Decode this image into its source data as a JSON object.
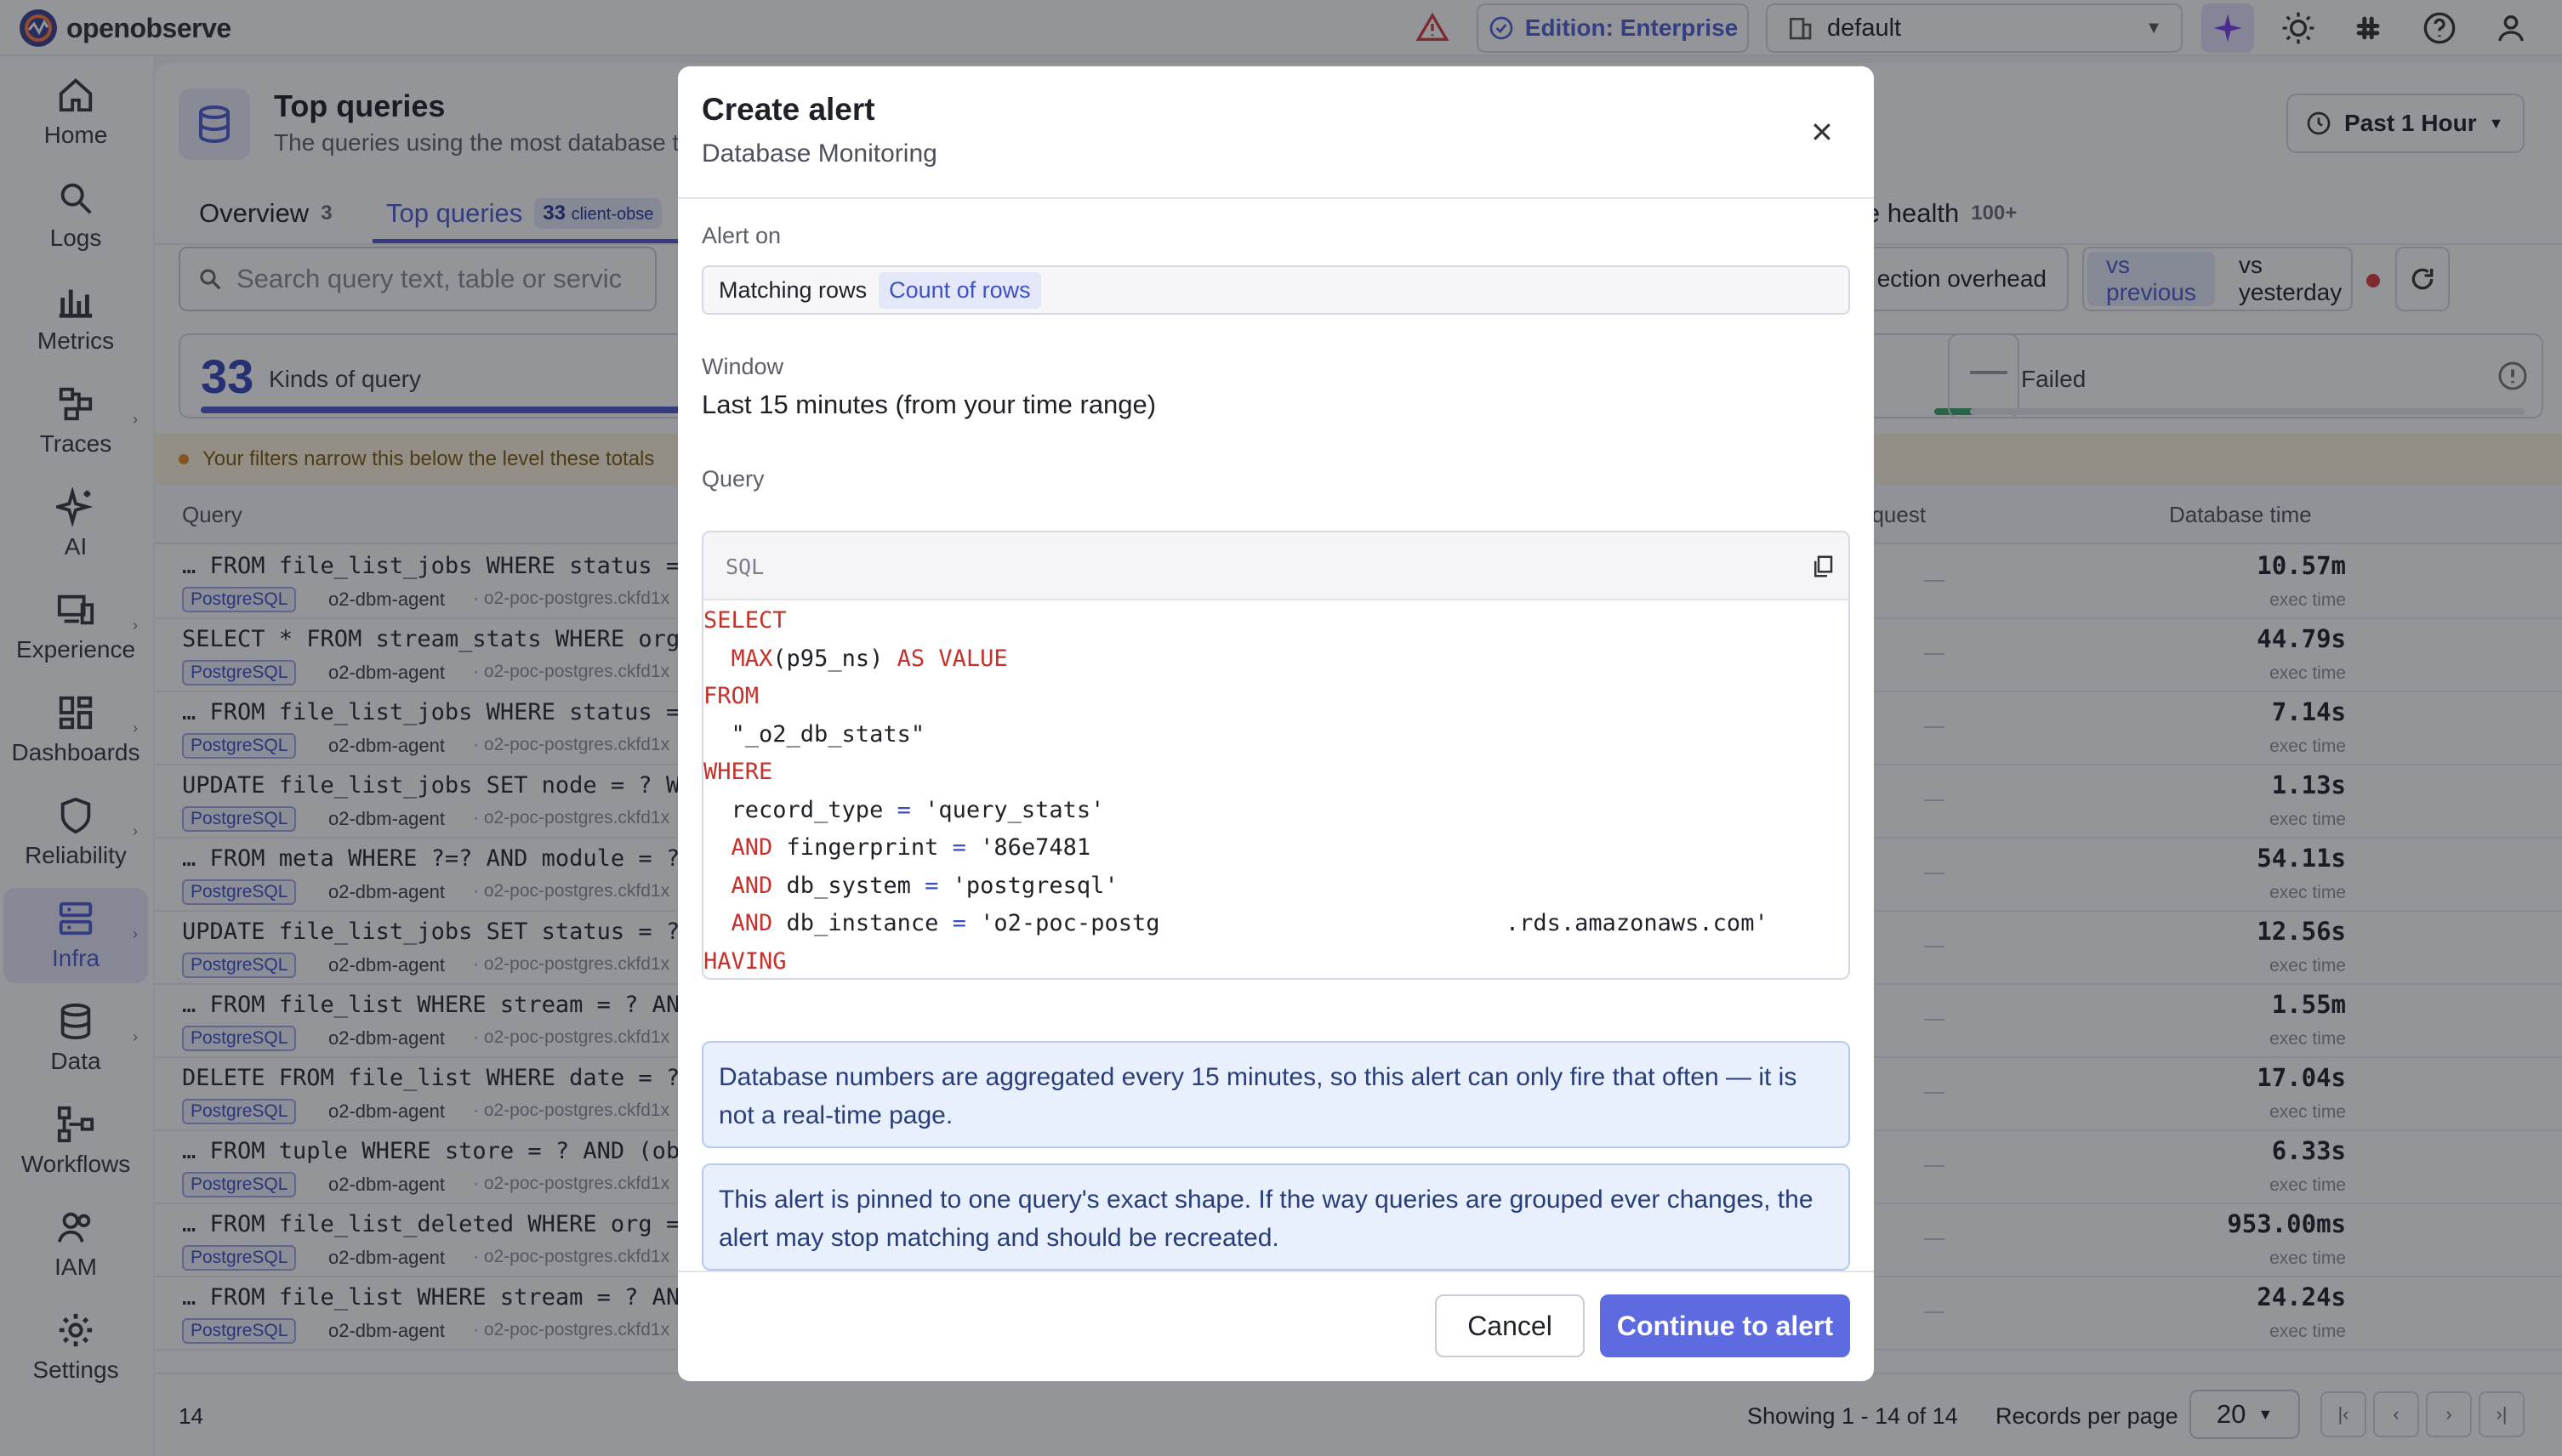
{
  "app": {
    "brand": "openobserve"
  },
  "topbar": {
    "edition_label": "Edition: Enterprise",
    "org_label": "default"
  },
  "sidebar": {
    "items": [
      {
        "label": "Home",
        "icon": "home-icon"
      },
      {
        "label": "Logs",
        "icon": "search-icon"
      },
      {
        "label": "Metrics",
        "icon": "bar-chart-icon"
      },
      {
        "label": "Traces",
        "icon": "traces-icon"
      },
      {
        "label": "AI",
        "icon": "sparkle-icon"
      },
      {
        "label": "Experience",
        "icon": "devices-icon"
      },
      {
        "label": "Dashboards",
        "icon": "dashboard-icon"
      },
      {
        "label": "Reliability",
        "icon": "shield-icon"
      },
      {
        "label": "Infra",
        "icon": "server-icon"
      },
      {
        "label": "Data",
        "icon": "database-icon"
      },
      {
        "label": "Workflows",
        "icon": "workflow-icon"
      },
      {
        "label": "IAM",
        "icon": "users-icon"
      },
      {
        "label": "Settings",
        "icon": "gear-icon"
      }
    ],
    "active": "Infra"
  },
  "page": {
    "title": "Top queries",
    "subtitle": "The queries using the most database ti",
    "time_range": "Past 1 Hour"
  },
  "tabs": [
    {
      "label": "Overview",
      "count": "3"
    },
    {
      "label": "Top queries",
      "count": "33",
      "badge": "client-obse"
    },
    {
      "label": "le health",
      "count": "100+"
    }
  ],
  "toolbar": {
    "search_placeholder": "Search query text, table or servic",
    "overhead_label": "ection overhead",
    "compare": [
      "vs previous",
      "vs yesterday"
    ],
    "compare_selected": "vs previous"
  },
  "kpis": {
    "kinds_value": "33",
    "kinds_label": "Kinds of query",
    "failed_label": "Failed"
  },
  "banner": {
    "text": "Your filters narrow this below the level these totals"
  },
  "table": {
    "headers": {
      "query": "Query",
      "per_request": "equest",
      "db_time": "Database time"
    },
    "rows": [
      {
        "query": "… FROM file_list_jobs WHERE status =",
        "engine": "PostgreSQL",
        "agent": "o2-dbm-agent",
        "host": "· o2-poc-postgres.ckfd1x",
        "db_time": "10.57m",
        "unit": "exec time"
      },
      {
        "query": "SELECT * FROM stream_stats WHERE org",
        "engine": "PostgreSQL",
        "agent": "o2-dbm-agent",
        "host": "· o2-poc-postgres.ckfd1x",
        "db_time": "44.79s",
        "unit": "exec time"
      },
      {
        "query": "… FROM file_list_jobs WHERE status =",
        "engine": "PostgreSQL",
        "agent": "o2-dbm-agent",
        "host": "· o2-poc-postgres.ckfd1x",
        "db_time": "7.14s",
        "unit": "exec time"
      },
      {
        "query": "UPDATE file_list_jobs SET node = ? WH",
        "engine": "PostgreSQL",
        "agent": "o2-dbm-agent",
        "host": "· o2-poc-postgres.ckfd1x",
        "db_time": "1.13s",
        "unit": "exec time"
      },
      {
        "query": "… FROM meta WHERE ?=? AND module = ?",
        "engine": "PostgreSQL",
        "agent": "o2-dbm-agent",
        "host": "· o2-poc-postgres.ckfd1x",
        "db_time": "54.11s",
        "unit": "exec time"
      },
      {
        "query": "UPDATE file_list_jobs SET status = ?,",
        "engine": "PostgreSQL",
        "agent": "o2-dbm-agent",
        "host": "· o2-poc-postgres.ckfd1x",
        "db_time": "12.56s",
        "unit": "exec time"
      },
      {
        "query": "… FROM file_list WHERE stream = ? AND",
        "engine": "PostgreSQL",
        "agent": "o2-dbm-agent",
        "host": "· o2-poc-postgres.ckfd1x",
        "db_time": "1.55m",
        "unit": "exec time"
      },
      {
        "query": "DELETE FROM file_list WHERE date = ?",
        "engine": "PostgreSQL",
        "agent": "o2-dbm-agent",
        "host": "· o2-poc-postgres.ckfd1x",
        "db_time": "17.04s",
        "unit": "exec time"
      },
      {
        "query": "… FROM tuple WHERE store = ? AND (obj",
        "engine": "PostgreSQL",
        "agent": "o2-dbm-agent",
        "host": "· o2-poc-postgres.ckfd1x",
        "db_time": "6.33s",
        "unit": "exec time"
      },
      {
        "query": "… FROM file_list_deleted WHERE org =",
        "engine": "PostgreSQL",
        "agent": "o2-dbm-agent",
        "host": "· o2-poc-postgres.ckfd1x",
        "db_time": "953.00ms",
        "unit": "exec time"
      },
      {
        "query": "… FROM file_list WHERE stream = ? AND",
        "engine": "PostgreSQL",
        "agent": "o2-dbm-agent",
        "host": "· o2-poc-postgres.ckfd1x",
        "db_time": "24.24s",
        "unit": "exec time"
      }
    ]
  },
  "footer": {
    "count": "14",
    "showing": "Showing 1 - 14 of 14",
    "records_label": "Records per page",
    "per_page": "20"
  },
  "modal": {
    "title": "Create alert",
    "subtitle": "Database Monitoring",
    "alert_on_label": "Alert on",
    "alert_on_value": "Matching rows",
    "alert_on_chip": "Count of rows",
    "window_label": "Window",
    "window_value": "Last 15 minutes (from your time range)",
    "query_label": "Query",
    "sql_lang": "SQL",
    "info1": "Database numbers are aggregated every 15 minutes, so this alert can only fire that often — it is not a real-time page.",
    "info2": "This alert is pinned to one query's exact shape. If the way queries are grouped ever changes, the alert may stop matching and should be recreated.",
    "cancel": "Cancel",
    "continue": "Continue to alert"
  },
  "colors": {
    "accent": "#5e6be0",
    "active_nav": "#4a5cd0",
    "sql_keyword": "#c4322b"
  }
}
